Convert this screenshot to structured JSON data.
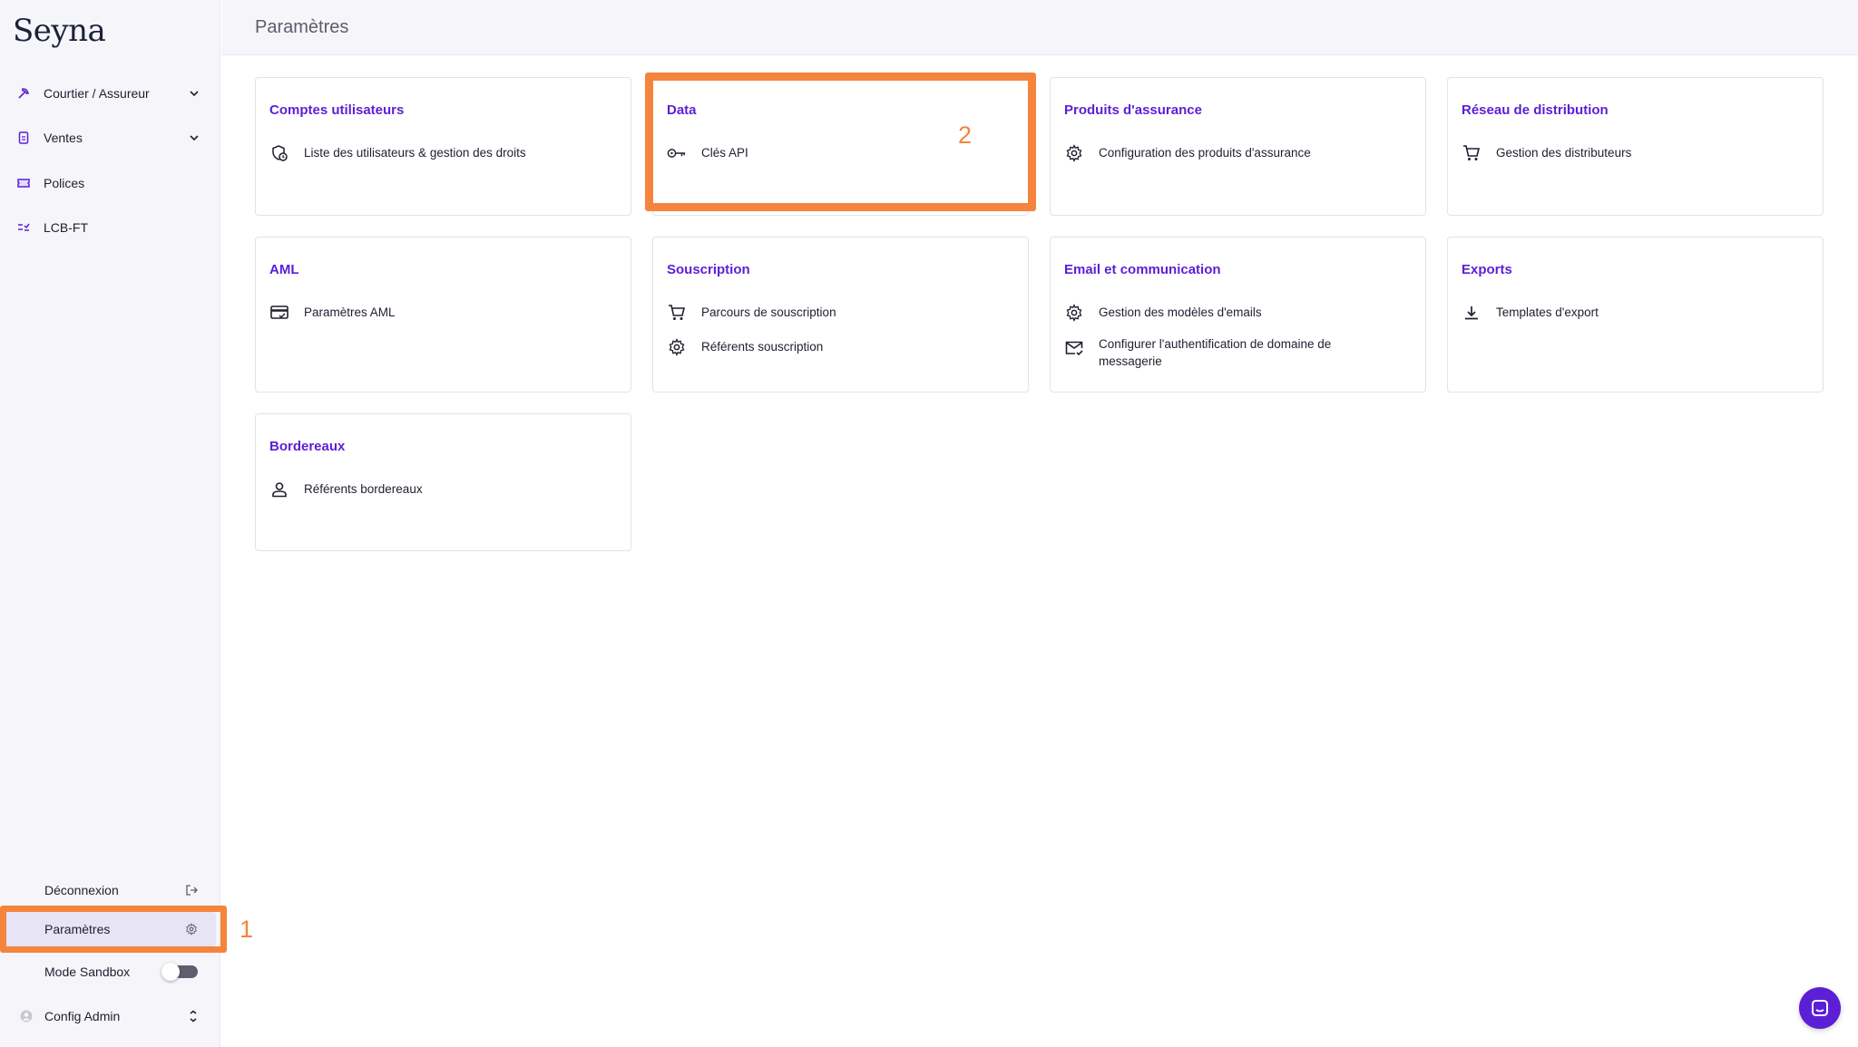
{
  "brand": {
    "logo": "Seyna",
    "accent": "#5b1fd6",
    "annotation_color": "#f5843c"
  },
  "sidebar": {
    "items": [
      {
        "label": "Courtier / Assureur",
        "icon": "pickaxe-icon",
        "expandable": true
      },
      {
        "label": "Ventes",
        "icon": "document-icon",
        "expandable": true
      },
      {
        "label": "Polices",
        "icon": "ticket-icon",
        "expandable": false
      },
      {
        "label": "LCB-FT",
        "icon": "checklist-icon",
        "expandable": false
      }
    ],
    "bottom": {
      "logout": {
        "label": "Déconnexion",
        "icon": "logout-icon"
      },
      "settings": {
        "label": "Paramètres",
        "icon": "gear-icon",
        "active": true
      },
      "sandbox": {
        "label": "Mode Sandbox",
        "enabled": false
      },
      "account": {
        "label": "Config Admin",
        "icon": "user-circle-icon"
      }
    }
  },
  "header": {
    "title": "Paramètres"
  },
  "annotations": {
    "first": "1",
    "second": "2"
  },
  "cards": [
    {
      "title": "Comptes utilisateurs",
      "rows": [
        {
          "label": "Liste des utilisateurs & gestion des droits",
          "icon": "user-shield-icon"
        }
      ]
    },
    {
      "title": "Data",
      "rows": [
        {
          "label": "Clés API",
          "icon": "key-icon"
        }
      ]
    },
    {
      "title": "Produits d'assurance",
      "rows": [
        {
          "label": "Configuration des produits d'assurance",
          "icon": "gear-icon"
        }
      ]
    },
    {
      "title": "Réseau de distribution",
      "rows": [
        {
          "label": "Gestion des distributeurs",
          "icon": "cart-icon"
        }
      ]
    },
    {
      "title": "AML",
      "rows": [
        {
          "label": "Paramètres AML",
          "icon": "card-check-icon"
        }
      ]
    },
    {
      "title": "Souscription",
      "rows": [
        {
          "label": "Parcours de souscription",
          "icon": "cart-icon"
        },
        {
          "label": "Référents souscription",
          "icon": "gear-icon"
        }
      ]
    },
    {
      "title": "Email et communication",
      "rows": [
        {
          "label": "Gestion des modèles d'emails",
          "icon": "gear-icon"
        },
        {
          "label": "Configurer l'authentification de domaine de messagerie",
          "icon": "mail-check-icon"
        }
      ]
    },
    {
      "title": "Exports",
      "rows": [
        {
          "label": "Templates d'export",
          "icon": "download-icon"
        }
      ]
    },
    {
      "title": "Bordereaux",
      "rows": [
        {
          "label": "Référents bordereaux",
          "icon": "user-icon"
        }
      ]
    }
  ]
}
